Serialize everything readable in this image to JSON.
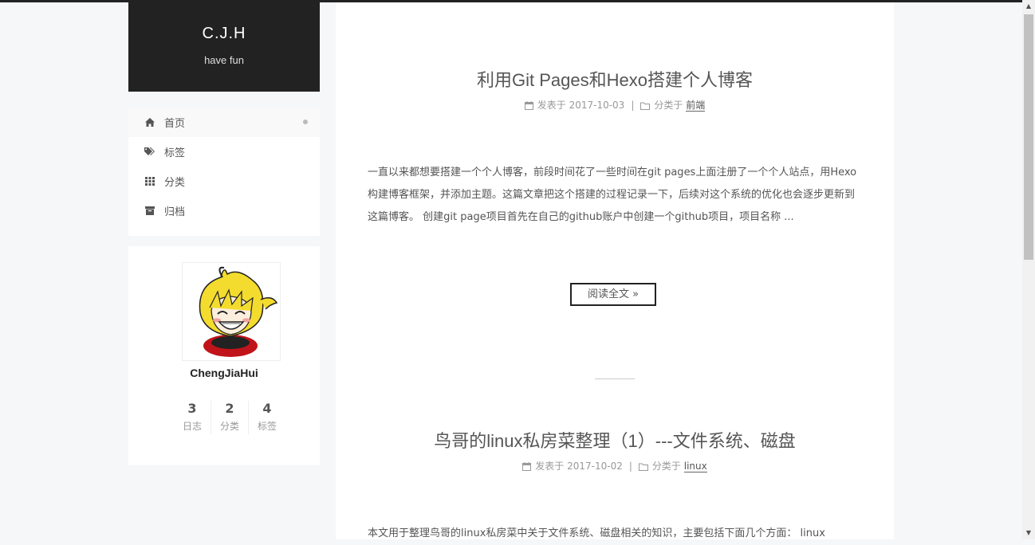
{
  "site": {
    "title": "C.J.H",
    "subtitle": "have fun"
  },
  "menu": [
    {
      "label": "首页",
      "icon": "home-icon",
      "active": true
    },
    {
      "label": "标签",
      "icon": "tags-icon"
    },
    {
      "label": "分类",
      "icon": "th-icon"
    },
    {
      "label": "归档",
      "icon": "archive-icon"
    }
  ],
  "author": {
    "name": "ChengJiaHui",
    "stats": [
      {
        "count": "3",
        "label": "日志"
      },
      {
        "count": "2",
        "label": "分类"
      },
      {
        "count": "4",
        "label": "标签"
      }
    ]
  },
  "posts": [
    {
      "title": "利用Git Pages和Hexo搭建个人博客",
      "meta_posted": "发表于 2017-10-03",
      "meta_sep": "|",
      "meta_cat_prefix": "分类于",
      "category": "前端",
      "excerpt": "一直以来都想要搭建一个个人博客，前段时间花了一些时间在git pages上面注册了一个个人站点，用Hexo构建博客框架，并添加主题。这篇文章把这个搭建的过程记录一下，后续对这个系统的优化也会逐步更新到这篇博客。 创建git page项目首先在自己的github账户中创建一个github项目，项目名称 ...",
      "read_more": "阅读全文 »"
    },
    {
      "title": "鸟哥的linux私房菜整理（1）---文件系统、磁盘",
      "meta_posted": "发表于 2017-10-02",
      "meta_sep": "|",
      "meta_cat_prefix": "分类于",
      "category": "linux",
      "excerpt": "本文用于整理鸟哥的linux私房菜中关于文件系统、磁盘相关的知识，主要包括下面几个方面： linux"
    }
  ],
  "colors": {
    "header_bg": "#222222",
    "page_bg": "#f5f7f9",
    "text": "#555555"
  }
}
